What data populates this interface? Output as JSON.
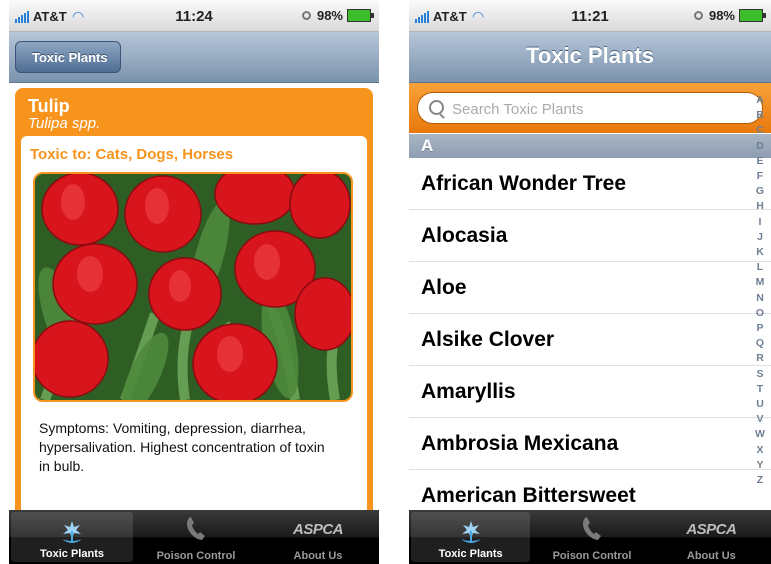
{
  "screens": [
    {
      "status": {
        "carrier": "AT&T",
        "time": "11:24",
        "battery": "98%"
      },
      "nav": {
        "back_label": "Toxic Plants"
      },
      "detail": {
        "name": "Tulip",
        "species": "Tulipa spp.",
        "toxic_to": "Toxic to: Cats, Dogs, Horses",
        "symptoms": "Symptoms: Vomiting, depression, diarrhea, hypersalivation. Highest concentration of toxin in bulb."
      },
      "tabs": [
        {
          "label": "Toxic Plants",
          "icon": "flower-icon",
          "selected": true
        },
        {
          "label": "Poison Control",
          "icon": "phone-icon",
          "selected": false
        },
        {
          "label": "About Us",
          "icon": "aspca-logo-icon",
          "logo_text": "ASPCA",
          "selected": false
        }
      ]
    },
    {
      "status": {
        "carrier": "AT&T",
        "time": "11:21",
        "battery": "98%"
      },
      "nav": {
        "title": "Toxic Plants"
      },
      "search": {
        "placeholder": "Search Toxic Plants",
        "value": ""
      },
      "section_header": "A",
      "list": [
        "African Wonder Tree",
        "Alocasia",
        "Aloe",
        "Alsike Clover",
        "Amaryllis",
        "Ambrosia Mexicana",
        "American Bittersweet"
      ],
      "index": [
        "A",
        "B",
        "C",
        "D",
        "E",
        "F",
        "G",
        "H",
        "I",
        "J",
        "K",
        "L",
        "M",
        "N",
        "O",
        "P",
        "Q",
        "R",
        "S",
        "T",
        "U",
        "V",
        "W",
        "X",
        "Y",
        "Z"
      ],
      "tabs": [
        {
          "label": "Toxic Plants",
          "icon": "flower-icon",
          "selected": true
        },
        {
          "label": "Poison Control",
          "icon": "phone-icon",
          "selected": false
        },
        {
          "label": "About Us",
          "icon": "aspca-logo-icon",
          "logo_text": "ASPCA",
          "selected": false
        }
      ]
    }
  ],
  "colors": {
    "accent_orange": "#f7941d",
    "nav_blue": "#7b93ae",
    "index_gray": "#6f7f93",
    "signal_blue": "#2a7fd8",
    "battery_green": "#3cbe2c"
  }
}
